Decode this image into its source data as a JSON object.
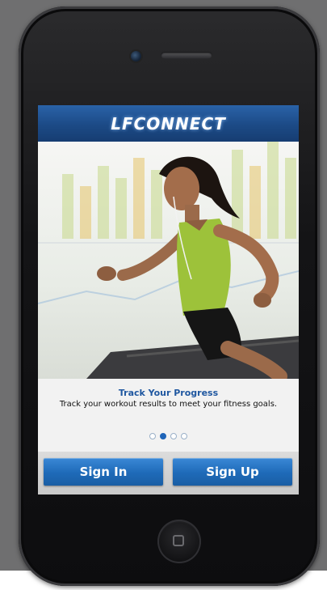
{
  "app": {
    "logo_text": "LFCONNECT"
  },
  "onboarding": {
    "title": "Track Your Progress",
    "description": "Track your workout results to meet your fitness goals.",
    "page_count": 4,
    "active_page": 2
  },
  "actions": {
    "sign_in_label": "Sign In",
    "sign_up_label": "Sign Up"
  },
  "colors": {
    "header_blue": "#1c4a86",
    "button_blue": "#1e6ab8",
    "title_blue": "#1f57a0"
  }
}
